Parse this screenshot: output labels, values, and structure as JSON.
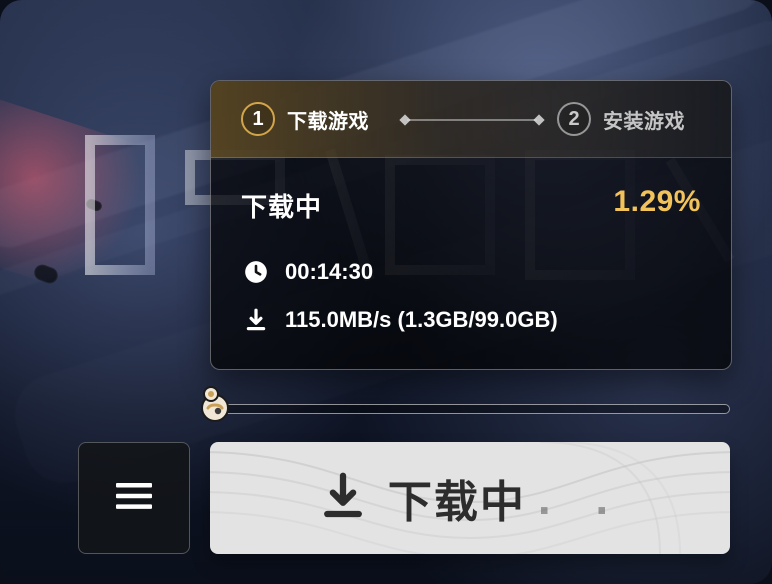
{
  "steps": [
    {
      "number": "1",
      "label": "下载游戏"
    },
    {
      "number": "2",
      "label": "安装游戏"
    }
  ],
  "status": {
    "title": "下载中",
    "percent": "1.29%",
    "progress_fraction": 0.0129
  },
  "info": {
    "time_remaining": "00:14:30",
    "speed_and_size": "115.0MB/s (1.3GB/99.0GB)"
  },
  "buttons": {
    "download_label": "下载中",
    "download_dots": ". ."
  },
  "icons": {
    "menu": "menu-icon",
    "clock": "clock-icon",
    "download": "download-icon",
    "progress_knob": "progress-knob-icon"
  },
  "colors": {
    "accent_gold": "#f2c35b",
    "panel_border": "#ffffff"
  }
}
